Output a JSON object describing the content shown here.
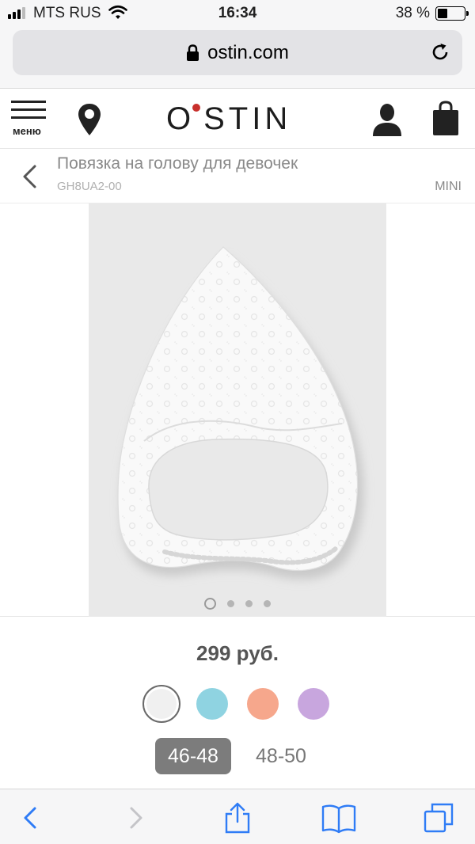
{
  "status_bar": {
    "carrier": "MTS RUS",
    "time": "16:34",
    "battery_percent": "38 %",
    "battery_level": 0.38,
    "icons": [
      "signal-icon",
      "wifi-icon",
      "battery-icon"
    ]
  },
  "browser": {
    "url": "ostin.com",
    "icons": [
      "lock-icon",
      "reload-icon"
    ]
  },
  "header": {
    "menu_label": "меню",
    "logo_text_left": "O",
    "logo_text_right": "STIN",
    "icons": [
      "menu-icon",
      "location-pin-icon",
      "user-icon",
      "shopping-bag-icon"
    ],
    "logo_dot_color": "#c8302c"
  },
  "product": {
    "name": "Повязка на голову для девочек",
    "sku": "GH8UA2-00",
    "mini_label": "MINI",
    "price": "299 руб.",
    "image_index": 1,
    "image_count": 4,
    "colors": [
      {
        "name": "white",
        "hex": "#f0f0f0",
        "selected": true
      },
      {
        "name": "light-blue",
        "hex": "#8fd3e1",
        "selected": false
      },
      {
        "name": "peach",
        "hex": "#f6a78c",
        "selected": false
      },
      {
        "name": "lilac",
        "hex": "#c8a6de",
        "selected": false
      }
    ],
    "sizes": [
      {
        "label": "46-48",
        "selected": true
      },
      {
        "label": "48-50",
        "selected": false
      }
    ]
  },
  "toolbar": {
    "icons": [
      "back-icon",
      "forward-icon",
      "share-icon",
      "bookmarks-icon",
      "tabs-icon"
    ]
  }
}
